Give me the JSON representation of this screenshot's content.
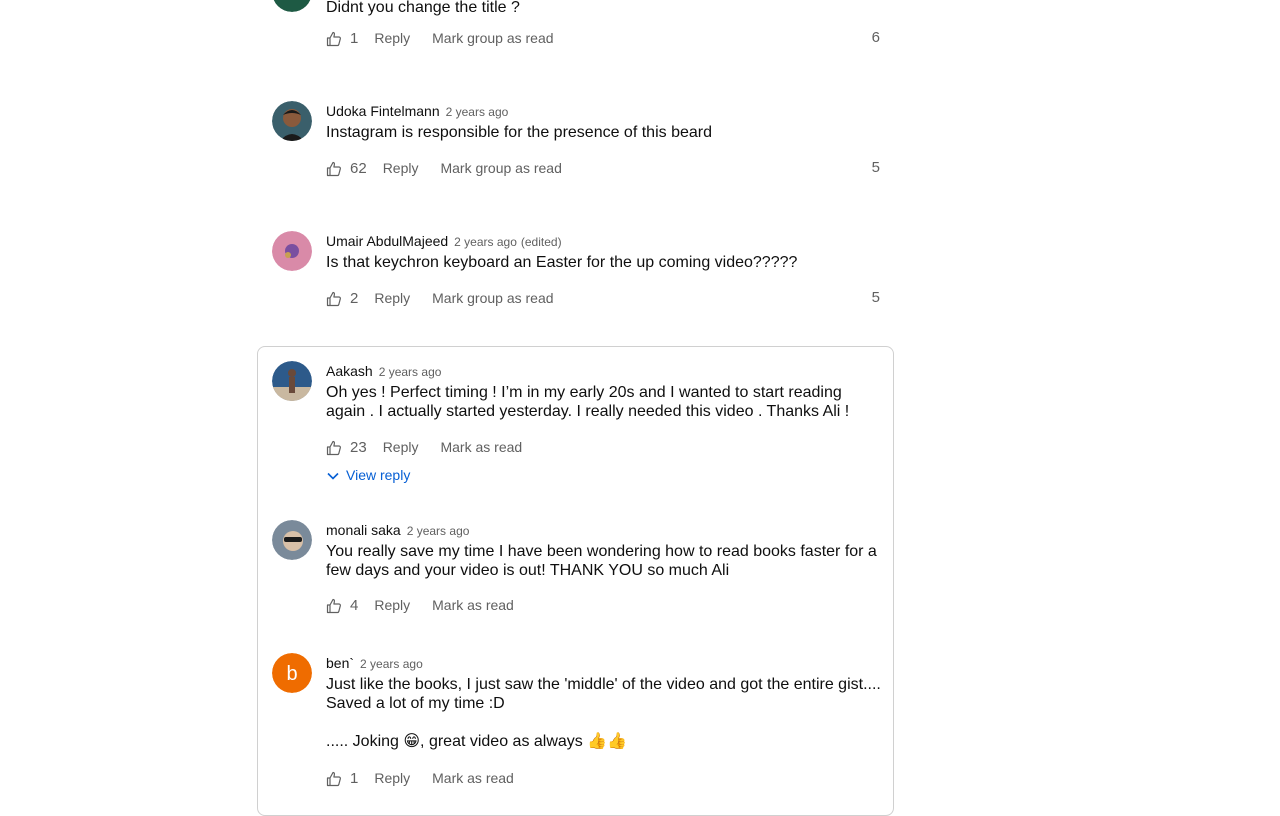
{
  "comments": [
    {
      "author": "",
      "time": "",
      "text": "Didnt you change the title ?",
      "likes": "1",
      "reply": "Reply",
      "mark": "Mark group as read",
      "count": "6",
      "avatar_color": "#1e5a44"
    },
    {
      "author": "Udoka Fintelmann",
      "time": "2 years ago",
      "text": "Instagram is responsible for the presence of this beard",
      "likes": "62",
      "reply": "Reply",
      "mark": "Mark group as read",
      "count": "5",
      "avatar_color": "#3a5f6b"
    },
    {
      "author": "Umair AbdulMajeed",
      "time": "2 years ago",
      "edited": "(edited)",
      "text": "Is that keychron keyboard an Easter for the up coming video?????",
      "likes": "2",
      "reply": "Reply",
      "mark": "Mark group as read",
      "count": "5",
      "avatar_color": "#d98aa8"
    },
    {
      "author": "Aakash",
      "time": "2 years ago",
      "text": "Oh yes ! Perfect timing ! I’m in my early 20s and I wanted to start reading again . I actually started yesterday. I really needed this video . Thanks Ali !",
      "likes": "23",
      "reply": "Reply",
      "mark": "Mark as read",
      "view_reply": "View reply",
      "avatar_color": "#2d5a8a"
    },
    {
      "author": "monali saka",
      "time": "2 years ago",
      "text": "You really save my time I have been wondering how to read books faster for a few days and your video is out! THANK YOU so much Ali",
      "likes": "4",
      "reply": "Reply",
      "mark": "Mark as read",
      "avatar_color": "#7a8a9a"
    },
    {
      "author": "ben`",
      "time": "2 years ago",
      "avatar_letter": "b",
      "text_line1": "Just like the books, I just saw the 'middle' of the video and got the entire gist.... Saved a lot of my time :D",
      "text_line2": "..... Joking 😁, great video as always 👍👍",
      "likes": "1",
      "reply": "Reply",
      "mark": "Mark as read",
      "avatar_color": "#ef6c00"
    }
  ]
}
